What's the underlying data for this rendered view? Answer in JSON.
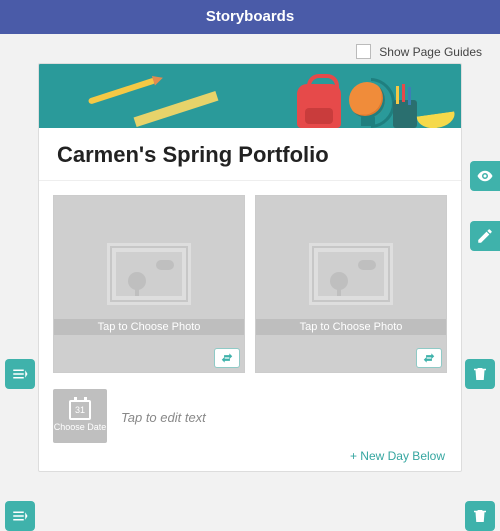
{
  "header": {
    "title": "Storyboards"
  },
  "toolbar": {
    "show_guides_label": "Show Page Guides"
  },
  "card": {
    "title": "Carmen's Spring Portfolio",
    "photos": [
      {
        "placeholder": "Tap to Choose Photo"
      },
      {
        "placeholder": "Tap to Choose Photo"
      }
    ],
    "date": {
      "label": "Choose Date",
      "day": "31"
    },
    "text_placeholder": "Tap to edit text",
    "new_day_label": "+ New Day Below"
  },
  "icons": {
    "eye": "eye-icon",
    "pencil": "pencil-icon",
    "lines": "lines-icon",
    "trash": "trash-icon",
    "swap": "swap-icon",
    "calendar": "calendar-icon"
  }
}
